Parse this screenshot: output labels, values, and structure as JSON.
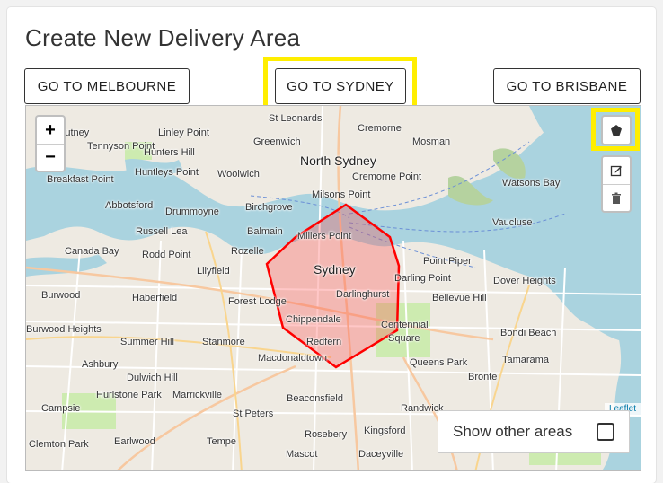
{
  "page": {
    "title": "Create New Delivery Area"
  },
  "buttons": {
    "melbourne": "GO TO MELBOURNE",
    "sydney": "GO TO SYDNEY",
    "brisbane": "GO TO BRISBANE"
  },
  "map": {
    "zoom_in": "+",
    "zoom_out": "−",
    "attribution": "Leaflet",
    "show_other_areas": "Show other areas",
    "show_other_areas_checked": false,
    "highlight_color": "#ffee00",
    "polygon_color": "#ff0000",
    "labels": {
      "leonards": "St Leonards",
      "cremorne": "Cremorne",
      "mosman": "Mosman",
      "putney": "Putney",
      "linley_point": "Linley Point",
      "greenwich": "Greenwich",
      "tennyson_point": "Tennyson Point",
      "hunters_hill": "Hunters Hill",
      "north_sydney": "North Sydney",
      "cremorne_point": "Cremorne Point",
      "huntleys_point": "Huntleys Point",
      "woolwich": "Woolwich",
      "breakfast_point": "Breakfast Point",
      "milsons_point": "Milsons Point",
      "watsons_bay": "Watsons Bay",
      "abbotsford": "Abbotsford",
      "drummoyne": "Drummoyne",
      "birchgrove": "Birchgrove",
      "vaucluse": "Vaucluse",
      "russell_lea": "Russell Lea",
      "balmain": "Balmain",
      "millers_point": "Millers Point",
      "canada_bay": "Canada Bay",
      "rodd_point": "Rodd Point",
      "rozelle": "Rozelle",
      "point_piper": "Point Piper",
      "sydney": "Sydney",
      "lilyfield": "Lilyfield",
      "darling_point": "Darling Point",
      "dover_heights": "Dover Heights",
      "burwood": "Burwood",
      "haberfield": "Haberfield",
      "forest_lodge": "Forest Lodge",
      "darlinghurst": "Darlinghurst",
      "bellevue_hill": "Bellevue Hill",
      "chippendale": "Chippendale",
      "centennial": "Centennial",
      "square": "Square",
      "burwood_heights": "Burwood Heights",
      "summer_hill": "Summer Hill",
      "stanmore": "Stanmore",
      "redfern": "Redfern",
      "bondi_beach": "Bondi Beach",
      "macdonaldtown": "Macdonaldtown",
      "ashbury": "Ashbury",
      "dulwich_hill": "Dulwich Hill",
      "queens_park": "Queens Park",
      "tamarama": "Tamarama",
      "bronte": "Bronte",
      "hurlstone_park": "Hurlstone Park",
      "marrickville": "Marrickville",
      "beaconsfield": "Beaconsfield",
      "campsie": "Campsie",
      "st_peters": "St Peters",
      "randwick": "Randwick",
      "clemton_park": "Clemton Park",
      "earlwood": "Earlwood",
      "tempe": "Tempe",
      "rosebery": "Rosebery",
      "kingsford": "Kingsford",
      "mascot": "Mascot",
      "daceyville": "Daceyville"
    }
  }
}
